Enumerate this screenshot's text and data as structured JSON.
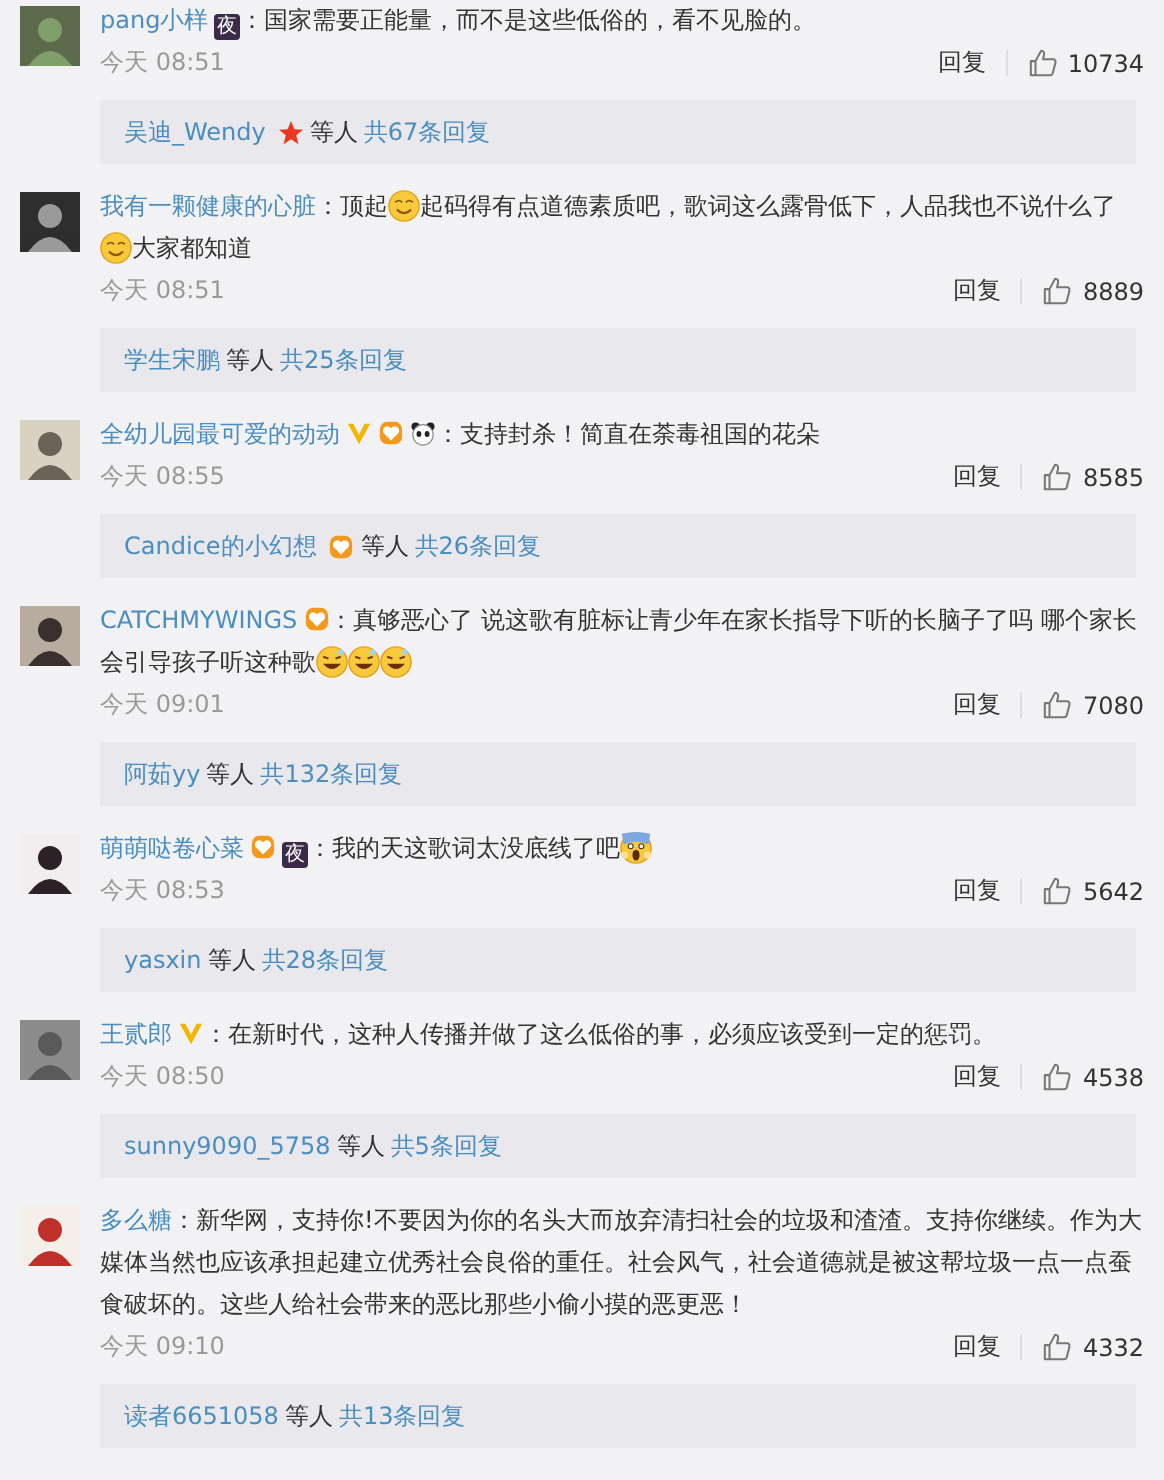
{
  "comments": [
    {
      "user": "pang小样",
      "badges": [
        {
          "kind": "night",
          "label": "夜"
        }
      ],
      "parts": [
        {
          "kind": "text",
          "text": "：国家需要正能量，而不是这些低俗的，看不见脸的。"
        }
      ],
      "time": "今天 08:51",
      "reply_label": "回复",
      "likes": "10734",
      "replies": {
        "user": "吴迪_Wendy",
        "badges": [
          {
            "kind": "star"
          }
        ],
        "others": "等人",
        "count": "共67条回复"
      }
    },
    {
      "user": "我有一颗健康的心脏",
      "parts": [
        {
          "kind": "text",
          "text": "：顶起"
        },
        {
          "kind": "smile"
        },
        {
          "kind": "text",
          "text": "起码得有点道德素质吧，歌词这么露骨低下，人品我也不说什么了"
        },
        {
          "kind": "smile"
        },
        {
          "kind": "text",
          "text": "大家都知道"
        }
      ],
      "time": "今天 08:51",
      "reply_label": "回复",
      "likes": "8889",
      "replies": {
        "user": "学生宋鹏",
        "others": "等人",
        "count": "共25条回复"
      }
    },
    {
      "user": "全幼儿园最可爱的动动",
      "badges": [
        {
          "kind": "verified"
        },
        {
          "kind": "fan"
        },
        {
          "kind": "panda"
        }
      ],
      "parts": [
        {
          "kind": "text",
          "text": "：支持封杀！简直在荼毒祖国的花朵"
        }
      ],
      "time": "今天 08:55",
      "reply_label": "回复",
      "likes": "8585",
      "replies": {
        "user": "Candice的小幻想",
        "badges": [
          {
            "kind": "fan"
          }
        ],
        "others": "等人",
        "count": "共26条回复"
      }
    },
    {
      "user": "CATCHMYWINGS",
      "badges": [
        {
          "kind": "fan"
        }
      ],
      "parts": [
        {
          "kind": "text",
          "text": "：真够恶心了 说这歌有脏标让青少年在家长指导下听的长脑子了吗 哪个家长会引导孩子听这种歌"
        },
        {
          "kind": "grin"
        },
        {
          "kind": "grin"
        },
        {
          "kind": "grin"
        }
      ],
      "time": "今天 09:01",
      "reply_label": "回复",
      "likes": "7080",
      "replies": {
        "user": "阿茹yy",
        "others": "等人",
        "count": "共132条回复"
      }
    },
    {
      "user": "萌萌哒卷心菜",
      "badges": [
        {
          "kind": "fan"
        },
        {
          "kind": "night",
          "label": "夜"
        }
      ],
      "parts": [
        {
          "kind": "text",
          "text": "：我的天这歌词太没底线了吧"
        },
        {
          "kind": "scream"
        }
      ],
      "time": "今天 08:53",
      "reply_label": "回复",
      "likes": "5642",
      "replies": {
        "user": "yasxin",
        "others": "等人",
        "count": "共28条回复"
      }
    },
    {
      "user": "王贰郎",
      "badges": [
        {
          "kind": "verified"
        }
      ],
      "parts": [
        {
          "kind": "text",
          "text": "：在新时代，这种人传播并做了这么低俗的事，必须应该受到一定的惩罚。"
        }
      ],
      "time": "今天 08:50",
      "reply_label": "回复",
      "likes": "4538",
      "replies": {
        "user": "sunny9090_5758",
        "others": "等人",
        "count": "共5条回复"
      }
    },
    {
      "user": "多么糖",
      "parts": [
        {
          "kind": "text",
          "text": "：新华网，支持你!不要因为你的名头大而放弃清扫社会的垃圾和渣渣。支持你继续。作为大媒体当然也应该承担起建立优秀社会良俗的重任。社会风气，社会道德就是被这帮垃圾一点一点蚕食破坏的。这些人给社会带来的恶比那些小偷小摸的恶更恶！"
        }
      ],
      "time": "今天 09:10",
      "reply_label": "回复",
      "likes": "4332",
      "replies": {
        "user": "读者6651058",
        "others": "等人",
        "count": "共13条回复"
      }
    }
  ]
}
